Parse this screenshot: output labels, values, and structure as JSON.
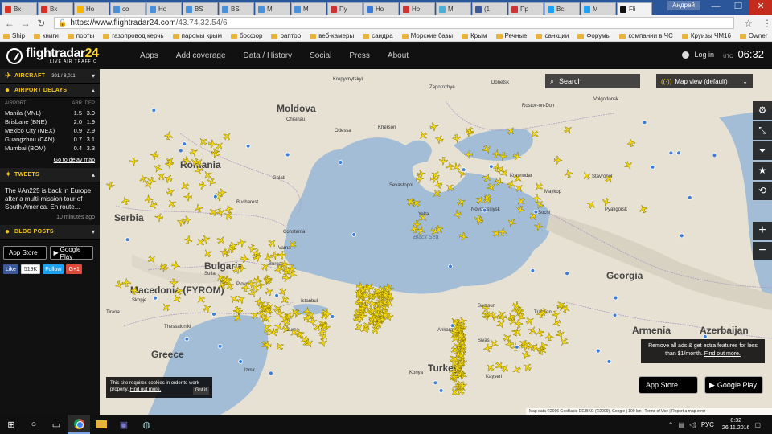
{
  "browser": {
    "tabs": [
      {
        "label": "Вх",
        "color": "#d93025"
      },
      {
        "label": "Вх",
        "color": "#d93025"
      },
      {
        "label": "Нo",
        "color": "#f7b500"
      },
      {
        "label": "co",
        "color": "#4a90d9"
      },
      {
        "label": "Нo",
        "color": "#4a90d9"
      },
      {
        "label": "BS",
        "color": "#4a90d9"
      },
      {
        "label": "BS",
        "color": "#4a90d9"
      },
      {
        "label": "M",
        "color": "#4a90d9"
      },
      {
        "label": "M",
        "color": "#4a90d9"
      },
      {
        "label": "Пу",
        "color": "#c33"
      },
      {
        "label": "Нo",
        "color": "#3a7bd5"
      },
      {
        "label": "Нo",
        "color": "#c33"
      },
      {
        "label": "M",
        "color": "#4ab0d9"
      },
      {
        "label": "(1",
        "color": "#3b5998"
      },
      {
        "label": "Пр",
        "color": "#c33"
      },
      {
        "label": "Вс",
        "color": "#1da1f2"
      },
      {
        "label": "M",
        "color": "#1da1f2"
      },
      {
        "label": "Fli",
        "color": "#111111"
      }
    ],
    "user_name": "Андрей",
    "window_controls": [
      "—",
      "❐",
      "✕"
    ],
    "url_host": "https://www.flightradar24.com",
    "url_path": "/43.74,32.54/6",
    "bookmarks": [
      "Ship",
      "книги",
      "порты",
      "газопровод керчь",
      "паромы крым",
      "босфор",
      "раптор",
      "веб-камеры",
      "сандра",
      "Морские базы",
      "Крым",
      "Речные",
      "санкции",
      "Форумы",
      "компании в ЧС",
      "Круизы ЧМ16",
      "Owner",
      "Милитари"
    ]
  },
  "header": {
    "logo_word": "flightradar",
    "logo_num": "24",
    "logo_sub": "LIVE AIR TRAFFIC",
    "nav": [
      "Apps",
      "Add coverage",
      "Data / History",
      "Social",
      "Press",
      "About"
    ],
    "login": "Log in",
    "utc_label": "UTC",
    "utc_time": "06:32"
  },
  "sidebar": {
    "aircraft_title": "AIRCRAFT",
    "aircraft_count": "391 / 8,011",
    "delays_title": "AIRPORT DELAYS",
    "delays_cols": [
      "AIRPORT",
      "ARR",
      "DEP"
    ],
    "delays": [
      {
        "airport": "Manila (MNL)",
        "arr": "1.5",
        "dep": "3.9"
      },
      {
        "airport": "Brisbane (BNE)",
        "arr": "2.0",
        "dep": "1.9"
      },
      {
        "airport": "Mexico City (MEX)",
        "arr": "0.9",
        "dep": "2.9"
      },
      {
        "airport": "Guangzhou (CAN)",
        "arr": "0.7",
        "dep": "3.1"
      },
      {
        "airport": "Mumbai (BOM)",
        "arr": "0.4",
        "dep": "3.3"
      }
    ],
    "delays_link": "Go to delay map",
    "tweets_title": "TWEETS",
    "tweet_text": "The #An225 is back in Europe after a multi-mission tour of South America. En route...",
    "tweet_time": "10 minutes ago",
    "blog_title": "BLOG POSTS",
    "app_store": "App Store",
    "google_play": "Google Play",
    "fb_like": "Like",
    "fb_count": "519K",
    "tw_follow": "Follow",
    "gplus": "G+1"
  },
  "map": {
    "search_placeholder": "Search",
    "view_label": "Map view (default)",
    "labels": [
      {
        "text": "Moldova",
        "kind": "country"
      },
      {
        "text": "Romania",
        "kind": "country"
      },
      {
        "text": "Bulgaria",
        "kind": "country"
      },
      {
        "text": "Serbia",
        "kind": "country"
      },
      {
        "text": "Greece",
        "kind": "country"
      },
      {
        "text": "Turkey",
        "kind": "country"
      },
      {
        "text": "Georgia",
        "kind": "country"
      },
      {
        "text": "Armenia",
        "kind": "country"
      },
      {
        "text": "Azerbaijan",
        "kind": "country"
      },
      {
        "text": "Macedonia (FYROM)",
        "kind": "country"
      },
      {
        "text": "Black Sea",
        "kind": "sea"
      },
      {
        "text": "Odessa",
        "kind": "city"
      },
      {
        "text": "Kherson",
        "kind": "city"
      },
      {
        "text": "Sevastopol",
        "kind": "city"
      },
      {
        "text": "Krasnodar",
        "kind": "city"
      },
      {
        "text": "Rostov-on-Don",
        "kind": "city"
      },
      {
        "text": "Donetsk",
        "kind": "city"
      },
      {
        "text": "Stavropol",
        "kind": "city"
      },
      {
        "text": "Sochi",
        "kind": "city"
      },
      {
        "text": "Bucharest",
        "kind": "city"
      },
      {
        "text": "Constanta",
        "kind": "city"
      },
      {
        "text": "Varna",
        "kind": "city"
      },
      {
        "text": "Sofia",
        "kind": "city"
      },
      {
        "text": "Istanbul",
        "kind": "city"
      },
      {
        "text": "Ankara",
        "kind": "city"
      },
      {
        "text": "Kayseri",
        "kind": "city"
      },
      {
        "text": "Izmir",
        "kind": "city"
      },
      {
        "text": "Volgodonsk",
        "kind": "city"
      },
      {
        "text": "Kropyvnytskyi",
        "kind": "city"
      },
      {
        "text": "Zaporozhye",
        "kind": "city"
      },
      {
        "text": "Novorossiysk",
        "kind": "city"
      },
      {
        "text": "Yalta",
        "kind": "city"
      },
      {
        "text": "Galati",
        "kind": "city"
      },
      {
        "text": "Maykop",
        "kind": "city"
      },
      {
        "text": "Pyatigorsk",
        "kind": "city"
      },
      {
        "text": "Sivas",
        "kind": "city"
      },
      {
        "text": "Samsun",
        "kind": "city"
      },
      {
        "text": "Trabzon",
        "kind": "city"
      },
      {
        "text": "Konya",
        "kind": "city"
      },
      {
        "text": "Bursa",
        "kind": "city"
      },
      {
        "text": "Plovdiv",
        "kind": "city"
      },
      {
        "text": "Skopje",
        "kind": "city"
      },
      {
        "text": "Tirana",
        "kind": "city"
      },
      {
        "text": "Thessaloniki",
        "kind": "city"
      },
      {
        "text": "Burgas",
        "kind": "city"
      },
      {
        "text": "Chisinau",
        "kind": "city"
      }
    ],
    "promo_text": "Remove all ads & get extra features for less than $1/month.",
    "promo_link": "Find out more.",
    "cookie_text": "This site requires cookies in order to work properly.",
    "cookie_link": "Find out more.",
    "cookie_btn": "Got it",
    "attribution": "Map data ©2016 GeoBasis-DE/BKG (©2009), Google | 100 km | Terms of Use | Report a map error",
    "tools": [
      "gear-icon",
      "filter-settings-icon",
      "filter-icon",
      "star-icon",
      "playback-icon"
    ]
  },
  "taskbar": {
    "lang": "РУС",
    "time": "8:32",
    "date": "26.11.2016"
  },
  "colors": {
    "accent": "#f5c518",
    "sea": "#a3bdd7",
    "land": "#e6e1d3",
    "plane": "#f5d90a"
  }
}
